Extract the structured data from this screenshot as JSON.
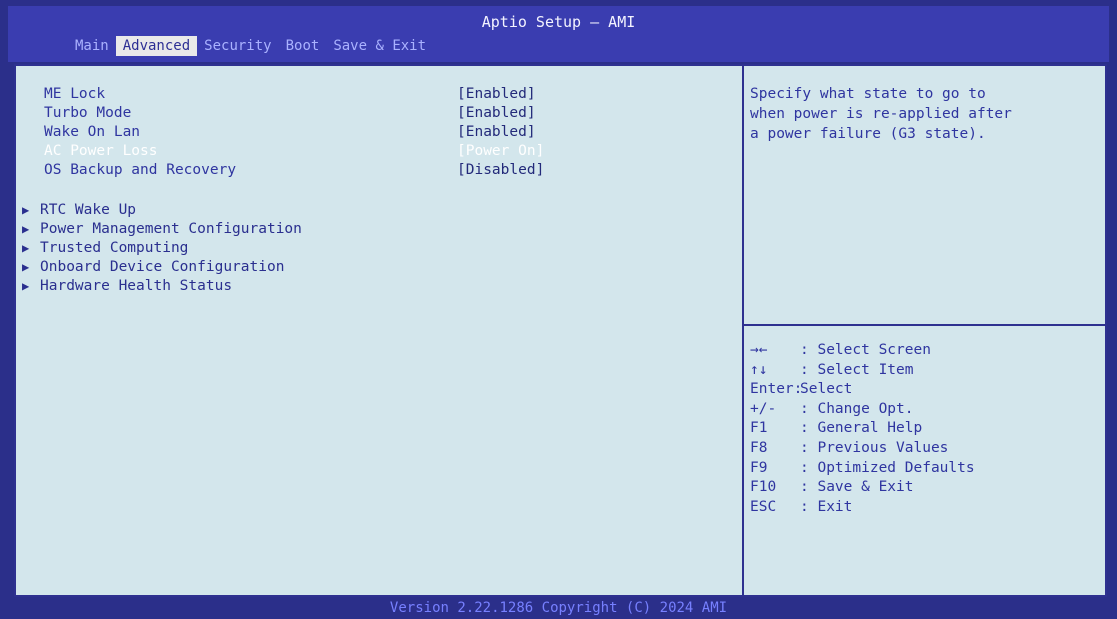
{
  "window": {
    "title": "Aptio Setup – AMI"
  },
  "tabs": [
    {
      "label": "Main"
    },
    {
      "label": "Advanced"
    },
    {
      "label": "Security"
    },
    {
      "label": "Boot"
    },
    {
      "label": "Save & Exit"
    }
  ],
  "settings": [
    {
      "label": "ME Lock",
      "value": "[Enabled]"
    },
    {
      "label": "Turbo Mode",
      "value": "[Enabled]"
    },
    {
      "label": "Wake On Lan",
      "value": "[Enabled]"
    },
    {
      "label": "AC Power Loss",
      "value": "[Power On]"
    },
    {
      "label": "OS Backup and Recovery",
      "value": "[Disabled]"
    }
  ],
  "submenus": [
    {
      "label": "RTC Wake Up"
    },
    {
      "label": "Power Management Configuration"
    },
    {
      "label": "Trusted Computing"
    },
    {
      "label": "Onboard Device Configuration"
    },
    {
      "label": "Hardware Health Status"
    }
  ],
  "help": {
    "lines": [
      "Specify what state to go to",
      "when power is re-applied after",
      "a power failure (G3 state)."
    ]
  },
  "keys": [
    {
      "key": "→←",
      "desc": ": Select Screen"
    },
    {
      "key": "↑↓",
      "desc": ": Select Item"
    },
    {
      "key": "Enter:",
      "desc": "Select"
    },
    {
      "key": "+/-",
      "desc": ": Change Opt."
    },
    {
      "key": "F1",
      "desc": ": General Help"
    },
    {
      "key": "F8",
      "desc": ": Previous Values"
    },
    {
      "key": "F9",
      "desc": ": Optimized Defaults"
    },
    {
      "key": "F10",
      "desc": ": Save & Exit"
    },
    {
      "key": "ESC",
      "desc": ": Exit"
    }
  ],
  "footer": {
    "text": "Version 2.22.1286 Copyright (C) 2024 AMI"
  },
  "state": {
    "active_tab": "Advanced",
    "selected_setting": "AC Power Loss"
  },
  "colors": {
    "background": "#2b2f8a",
    "panel": "#d3e6ec",
    "accent": "#3a3db0",
    "text": "#2f35a0",
    "selected_text": "#ffffff"
  },
  "icons": {
    "submenu_arrow": "triangle-right-icon"
  }
}
